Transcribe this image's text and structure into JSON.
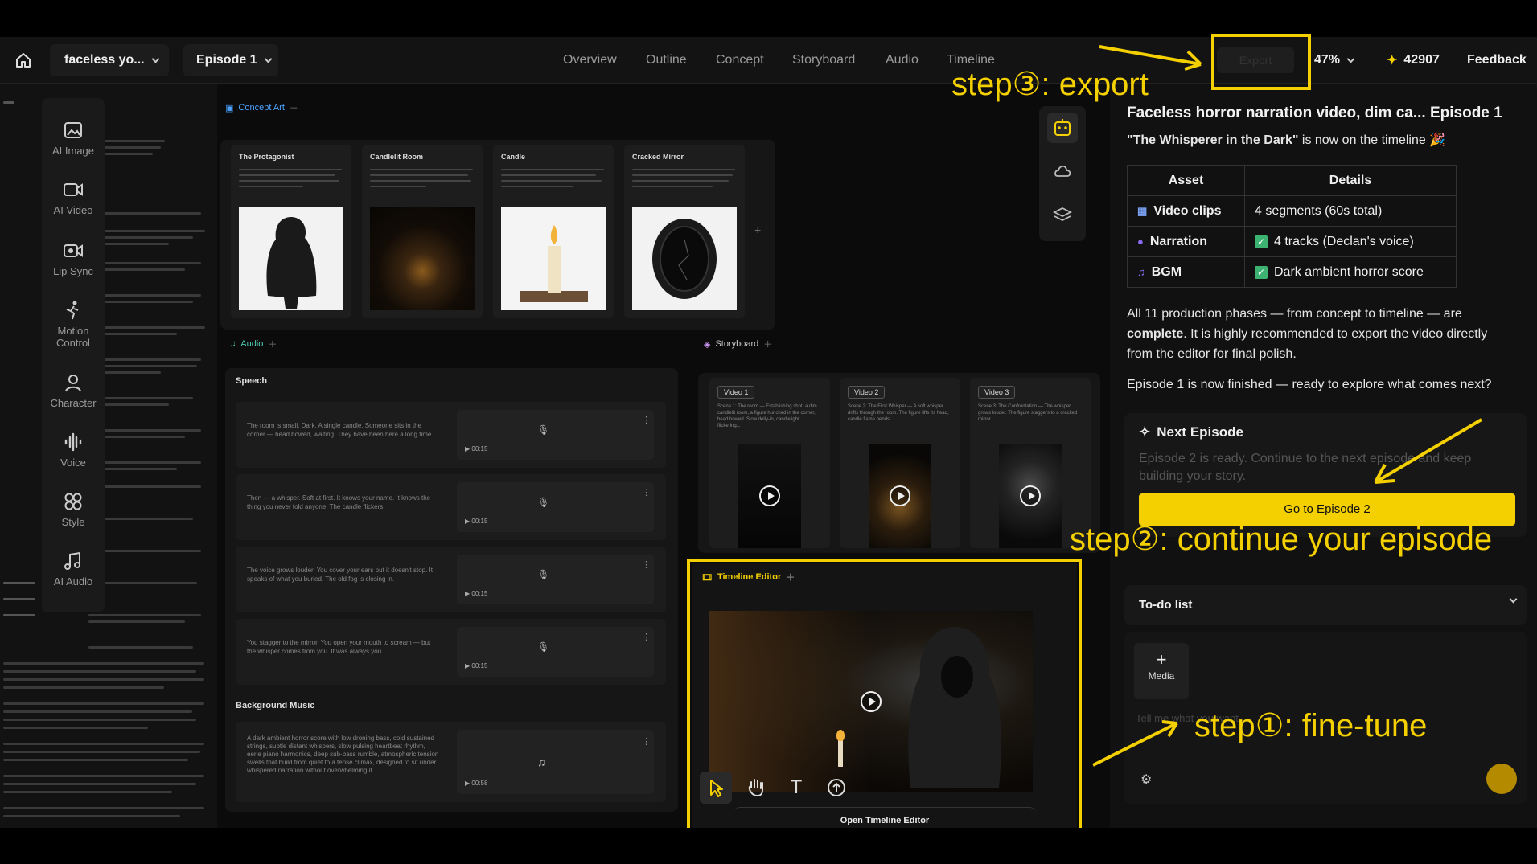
{
  "header": {
    "project": "faceless yo...",
    "episode": "Episode 1",
    "tabs": [
      "Overview",
      "Outline",
      "Concept",
      "Storyboard",
      "Audio",
      "Timeline"
    ],
    "export_label": "Export",
    "zoom": "47%",
    "credits": "42907",
    "feedback": "Feedback"
  },
  "tools": [
    "AI Image",
    "AI Video",
    "Lip Sync",
    "Motion Control",
    "Character",
    "Voice",
    "Style",
    "AI Audio"
  ],
  "concept": {
    "tag": "Concept Art",
    "cards": [
      {
        "title": "The Protagonist"
      },
      {
        "title": "Candlelit Room"
      },
      {
        "title": "Candle"
      },
      {
        "title": "Cracked Mirror"
      }
    ]
  },
  "audio": {
    "tag": "Audio",
    "speech_label": "Speech",
    "rows": [
      {
        "text": "The room is small. Dark. A single candle. Someone sits in the corner — head bowed, waiting. They have been here a long time.",
        "time": "00:15"
      },
      {
        "text": "Then — a whisper. Soft at first. It knows your name. It knows the thing you never told anyone. The candle flickers.",
        "time": "00:15"
      },
      {
        "text": "The voice grows louder. You cover your ears but it doesn't stop. It speaks of what you buried. The old fog is closing in.",
        "time": "00:15"
      },
      {
        "text": "You stagger to the mirror. You open your mouth to scream — but the whisper comes from you. It was always you.",
        "time": "00:15"
      }
    ],
    "bgm_label": "Background Music",
    "bgm": {
      "text": "A dark ambient horror score with low droning bass, cold sustained strings, subtle distant whispers, slow pulsing heartbeat rhythm, eerie piano harmonics, deep sub-bass rumble, atmospheric tension swells that build from quiet to a tense climax, designed to sit under whispered narration without overwhelming it.",
      "time": "00:58"
    }
  },
  "storyboard": {
    "tag": "Storyboard",
    "videos": [
      {
        "label": "Video 1",
        "desc": "Scene 1: The room — Establishing shot, a dim candlelit room, a figure hunched in the corner, head bowed. Slow dolly-in, candlelight flickering..."
      },
      {
        "label": "Video 2",
        "desc": "Scene 2: The First Whisper — A soft whisper drifts through the room. The figure lifts its head, candle flame bends..."
      },
      {
        "label": "Video 3",
        "desc": "Scene 3: The Confrontation — The whisper grows louder. The figure staggers to a cracked mirror..."
      }
    ]
  },
  "timeline_editor": {
    "tag": "Timeline Editor",
    "open_label": "Open Timeline Editor"
  },
  "chat": {
    "title": "Faceless horror narration video, dim ca... Episode 1",
    "subtitle_bold": "\"The Whisperer in the Dark\"",
    "subtitle_rest": " is now on the timeline 🎉",
    "table_headers": [
      "Asset",
      "Details"
    ],
    "table_rows": [
      {
        "asset": "Video clips",
        "details": "4 segments (60s total)"
      },
      {
        "asset": "Narration",
        "details": "4 tracks (Declan's voice)"
      },
      {
        "asset": "BGM",
        "details": "Dark ambient horror score"
      }
    ],
    "para1_a": "All 11 production phases — from concept to timeline — are ",
    "para1_b": "complete",
    "para1_c": ". It is highly recommended to export the video directly from the editor for final polish.",
    "para2": "Episode 1 is now finished — ready to explore what comes next?",
    "next_title": "Next Episode",
    "next_desc": "Episode 2 is ready. Continue to the next episode and keep building your story.",
    "next_button": "Go to Episode 2",
    "todo": "To-do list",
    "media": "Media",
    "input_placeholder": "Tell me what you want"
  },
  "annotations": {
    "step1": "step①: fine-tune",
    "step2": "step②: continue your episode",
    "step3": "step③: export"
  },
  "colors": {
    "accent": "#f5d000",
    "bg": "#0b0b0b",
    "panel": "#161616"
  }
}
